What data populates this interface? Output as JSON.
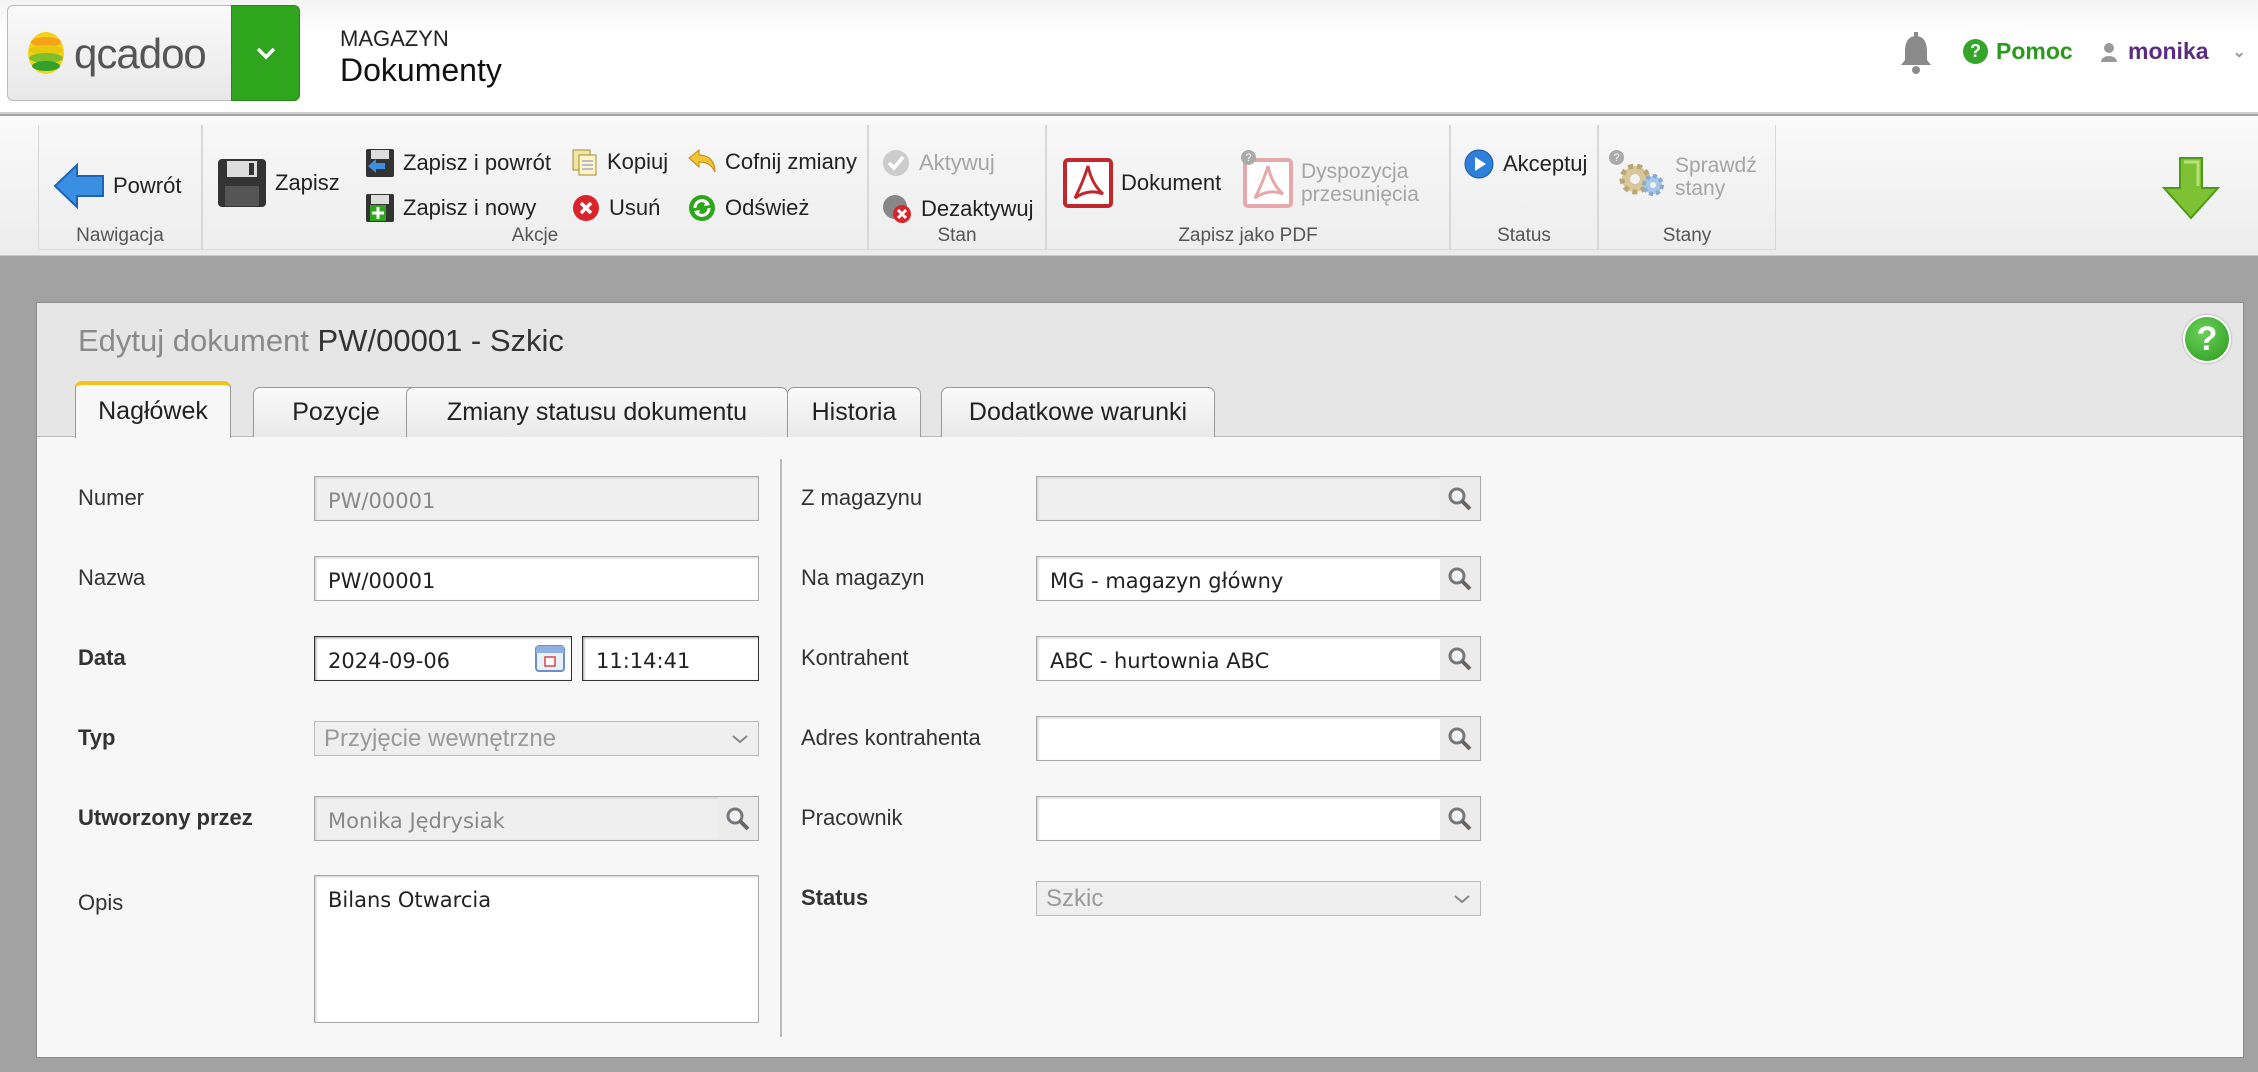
{
  "app": {
    "logo_text": "qcadoo",
    "module": "MAGAZYN",
    "page_title": "Dokumenty"
  },
  "header": {
    "help_label": "Pomoc",
    "user_name": "monika"
  },
  "ribbon": {
    "nav_group": "Nawigacja",
    "back": "Powrót",
    "actions_group": "Akcje",
    "save": "Zapisz",
    "save_and_back": "Zapisz i powrót",
    "save_and_new": "Zapisz i nowy",
    "copy": "Kopiuj",
    "delete": "Usuń",
    "undo": "Cofnij zmiany",
    "refresh": "Odśwież",
    "state_group": "Stan",
    "activate": "Aktywuj",
    "deactivate": "Dezaktywuj",
    "pdf_group": "Zapisz jako PDF",
    "document": "Dokument",
    "transfer_line1": "Dyspozycja",
    "transfer_line2": "przesunięcia",
    "status_group": "Status",
    "accept": "Akceptuj",
    "stocks_group": "Stany",
    "check_line1": "Sprawdź",
    "check_line2": "stany"
  },
  "form": {
    "title_prefix": "Edytuj dokument",
    "title_doc": "PW/00001 - Szkic",
    "tabs": [
      "Nagłówek",
      "Pozycje",
      "Zmiany statusu dokumentu",
      "Historia",
      "Dodatkowe warunki"
    ],
    "left": {
      "numer_label": "Numer",
      "numer_value": "PW/00001",
      "nazwa_label": "Nazwa",
      "nazwa_value": "PW/00001",
      "data_label": "Data",
      "date_value": "2024-09-06",
      "time_value": "11:14:41",
      "typ_label": "Typ",
      "typ_value": "Przyjęcie wewnętrzne",
      "utworzony_label": "Utworzony przez",
      "utworzony_value": "Monika  Jędrysiak",
      "opis_label": "Opis",
      "opis_value": "Bilans Otwarcia"
    },
    "right": {
      "z_mag_label": "Z magazynu",
      "z_mag_value": "",
      "na_mag_label": "Na magazyn",
      "na_mag_value": "MG - magazyn główny",
      "kontrahent_label": "Kontrahent",
      "kontrahent_value": "ABC - hurtownia ABC",
      "adres_label": "Adres kontrahenta",
      "adres_value": "",
      "pracownik_label": "Pracownik",
      "pracownik_value": "",
      "status_label": "Status",
      "status_value": "Szkic"
    }
  },
  "colors": {
    "accent_green": "#2ea51c",
    "tab_active": "#f1c21b",
    "user": "#5a2d82"
  }
}
